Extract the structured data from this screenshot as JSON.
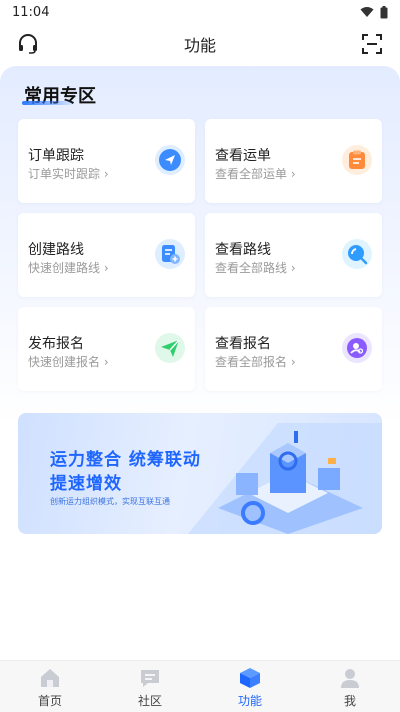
{
  "status_bar": {
    "time": "11:04"
  },
  "header": {
    "title": "功能"
  },
  "section": {
    "title": "常用专区"
  },
  "cards": [
    {
      "title": "订单跟踪",
      "subtitle": "订单实时跟踪 ›",
      "icon": "send-icon"
    },
    {
      "title": "查看运单",
      "subtitle": "查看全部运单 ›",
      "icon": "clipboard-icon"
    },
    {
      "title": "创建路线",
      "subtitle": "快速创建路线 ›",
      "icon": "route-add-icon"
    },
    {
      "title": "查看路线",
      "subtitle": "查看全部路线 ›",
      "icon": "search-route-icon"
    },
    {
      "title": "发布报名",
      "subtitle": "快速创建报名 ›",
      "icon": "paper-plane-icon"
    },
    {
      "title": "查看报名",
      "subtitle": "查看全部报名 ›",
      "icon": "user-search-icon"
    }
  ],
  "banner": {
    "line1": "运力整合 统筹联动",
    "line2": "提速增效",
    "subtitle": "创新运力组织模式，实现互联互通"
  },
  "tabbar": {
    "items": [
      {
        "label": "首页",
        "icon": "home-icon",
        "active": false
      },
      {
        "label": "社区",
        "icon": "chat-icon",
        "active": false
      },
      {
        "label": "功能",
        "icon": "cube-icon",
        "active": true
      },
      {
        "label": "我",
        "icon": "person-icon",
        "active": false
      }
    ]
  },
  "colors": {
    "accent": "#1f66ff",
    "icon_blue": "#3c8cff",
    "icon_orange": "#ff8a3a",
    "icon_green": "#2fcf6e",
    "icon_purple": "#8a5cff"
  }
}
